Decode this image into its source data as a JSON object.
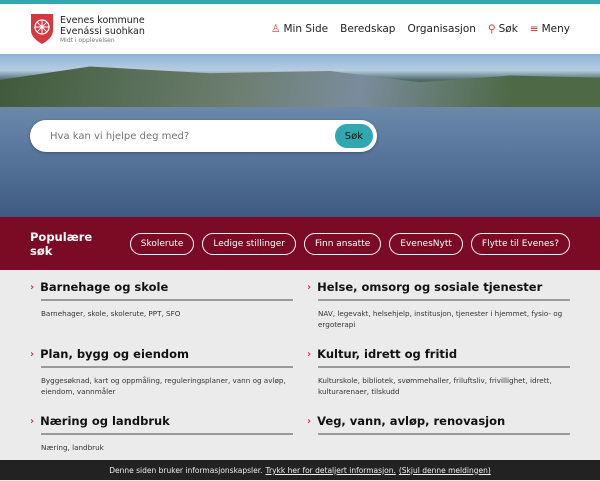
{
  "header": {
    "logo_line1": "Evenes kommune",
    "logo_line2": "Evenássi suohkan",
    "logo_tagline": "Midt i opplevelsen",
    "nav": [
      {
        "label": "Min Side",
        "icon": "user-icon"
      },
      {
        "label": "Beredskap"
      },
      {
        "label": "Organisasjon"
      },
      {
        "label": "Søk",
        "icon": "search-icon"
      },
      {
        "label": "Meny",
        "icon": "menu-icon"
      }
    ]
  },
  "hero": {
    "search_placeholder": "Hva kan vi hjelpe deg med?",
    "search_button": "Søk"
  },
  "popular": {
    "title": "Populære søk",
    "chips": [
      "Skolerute",
      "Ledige stillinger",
      "Finn ansatte",
      "EvenesNytt",
      "Flytte til Evenes?"
    ]
  },
  "categories": [
    {
      "title": "Barnehage og skole",
      "desc": "Barnehager, skole, skolerute, PPT, SFO"
    },
    {
      "title": "Helse, omsorg og sosiale tjenester",
      "desc": "NAV, legevakt, helsehjelp, institusjon, tjenester i hjemmet, fysio- og ergoterapi"
    },
    {
      "title": "Plan, bygg og eiendom",
      "desc": "Byggesøknad, kart og oppmåling, reguleringsplaner, vann og avløp, eiendom, vannmåler"
    },
    {
      "title": "Kultur, idrett og fritid",
      "desc": "Kulturskole, bibliotek, svømmehaller, friluftsliv, frivillighet, idrett, kulturarenaer, tilskudd"
    },
    {
      "title": "Næring og landbruk",
      "desc": "Næring, landbruk"
    },
    {
      "title": "Veg, vann, avløp, renovasjon",
      "desc": ""
    }
  ],
  "cookie": {
    "text": "Denne siden bruker informasjonskapsler.",
    "link": "Trykk her for detaljert informasjon.",
    "hide": "(Skjul denne meldingen)"
  },
  "colors": {
    "accent": "#2fa9b0",
    "brand": "#7b0a24",
    "red": "#d9363e"
  }
}
